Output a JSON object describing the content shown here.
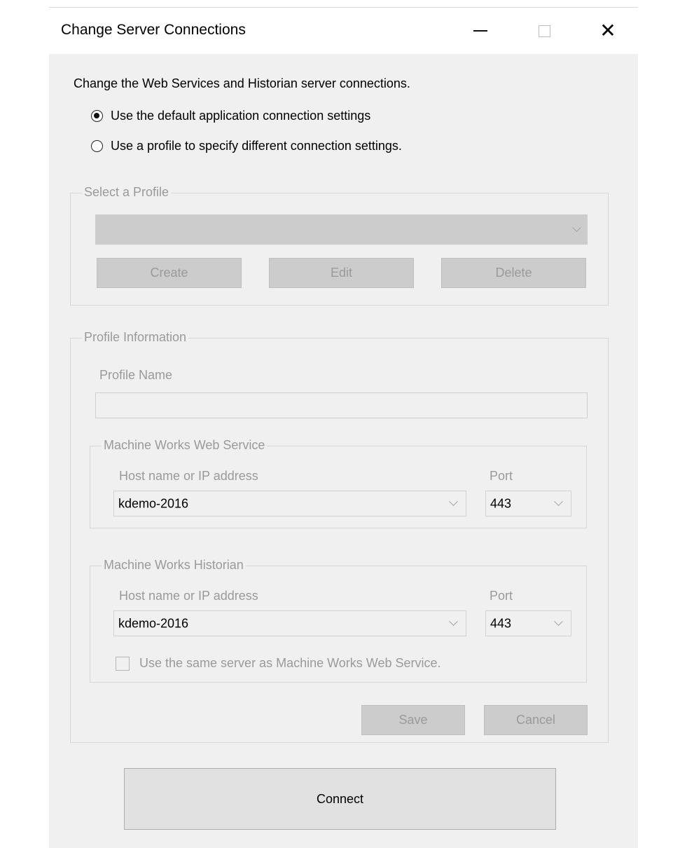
{
  "window": {
    "title": "Change Server Connections",
    "minimize_icon": "minimize-icon",
    "maximize_icon": "maximize-icon",
    "close_icon": "close-icon"
  },
  "intro": "Change the Web Services and Historian server connections.",
  "mode_options": [
    {
      "label": "Use the default application connection settings",
      "checked": true
    },
    {
      "label": "Use a profile to specify different connection settings.",
      "checked": false
    }
  ],
  "select_profile": {
    "legend": "Select a Profile",
    "selected": "",
    "buttons": {
      "create": "Create",
      "edit": "Edit",
      "delete": "Delete"
    }
  },
  "profile_info": {
    "legend": "Profile Information",
    "profile_name_label": "Profile Name",
    "profile_name_value": "",
    "web_service": {
      "legend": "Machine Works Web Service",
      "host_label": "Host name or IP address",
      "host_value": "kdemo-2016",
      "port_label": "Port",
      "port_value": "443"
    },
    "historian": {
      "legend": "Machine Works Historian",
      "host_label": "Host name or IP address",
      "host_value": "kdemo-2016",
      "port_label": "Port",
      "port_value": "443",
      "same_server_label": "Use the same server as Machine Works Web Service.",
      "same_server_checked": false
    },
    "buttons": {
      "save": "Save",
      "cancel": "Cancel"
    }
  },
  "connect_label": "Connect",
  "colors": {
    "window_bg": "#f0f0f0",
    "disabled_text": "#9a9a9a",
    "disabled_control": "#cccccc"
  }
}
